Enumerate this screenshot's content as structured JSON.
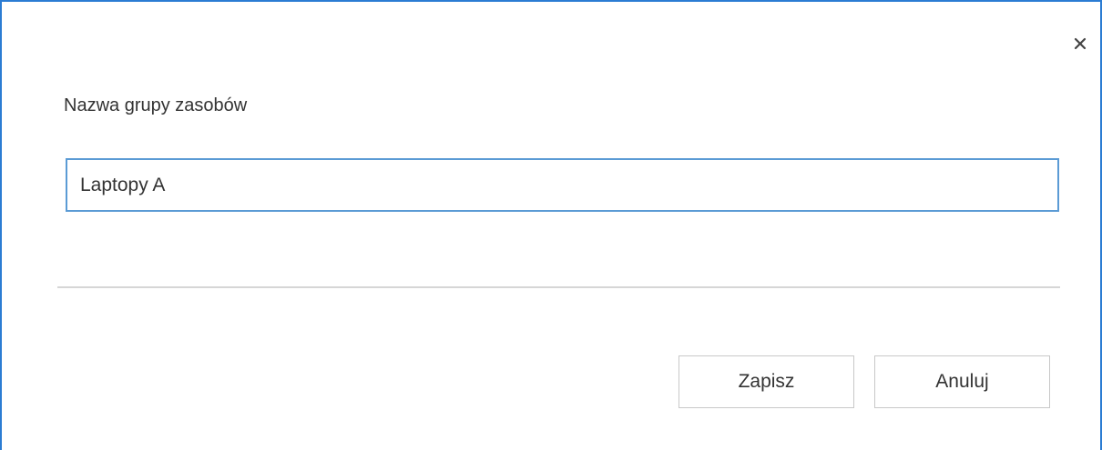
{
  "dialog": {
    "close_icon": "close-icon",
    "field_label": "Nazwa grupy zasobów",
    "input_value": "Laptopy A",
    "input_placeholder": "",
    "buttons": {
      "save_label": "Zapisz",
      "cancel_label": "Anuluj"
    }
  },
  "colors": {
    "accent_border": "#2b7cd3",
    "input_focus_border": "#5b9bd5",
    "divider": "#d6d6d6",
    "button_border": "#c8c8c8",
    "text": "#333333"
  }
}
